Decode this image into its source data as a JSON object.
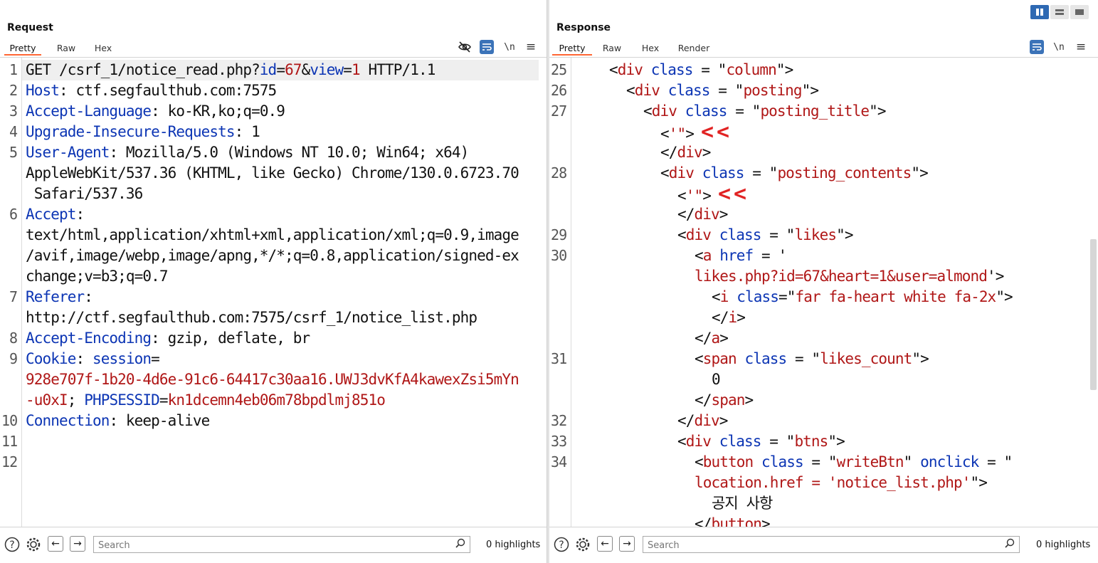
{
  "request": {
    "title": "Request",
    "tabs": [
      "Pretty",
      "Raw",
      "Hex"
    ],
    "newline_label": "\\n",
    "menu_glyph": "≡",
    "lines": [
      {
        "n": "1",
        "parts": [
          [
            "t",
            "GET /csrf_1/notice_read.php?"
          ],
          [
            "k",
            "id"
          ],
          [
            "t",
            "="
          ],
          [
            "v",
            "67"
          ],
          [
            "t",
            "&"
          ],
          [
            "k",
            "view"
          ],
          [
            "t",
            "="
          ],
          [
            "v",
            "1"
          ],
          [
            "t",
            " HTTP/1.1"
          ]
        ]
      },
      {
        "n": "2",
        "parts": [
          [
            "k",
            "Host"
          ],
          [
            "t",
            ": ctf.segfaulthub.com:7575"
          ]
        ]
      },
      {
        "n": "3",
        "parts": [
          [
            "k",
            "Accept-Language"
          ],
          [
            "t",
            ": ko-KR,ko;q=0.9"
          ]
        ]
      },
      {
        "n": "4",
        "parts": [
          [
            "k",
            "Upgrade-Insecure-Requests"
          ],
          [
            "t",
            ": 1"
          ]
        ]
      },
      {
        "n": "5",
        "parts": [
          [
            "k",
            "User-Agent"
          ],
          [
            "t",
            ": Mozilla/5.0 (Windows NT 10.0; Win64; x64)"
          ]
        ]
      },
      {
        "n": "",
        "parts": [
          [
            "t",
            "AppleWebKit/537.36 (KHTML, like Gecko) Chrome/130.0.6723.70"
          ]
        ]
      },
      {
        "n": "",
        "parts": [
          [
            "t",
            " Safari/537.36"
          ]
        ]
      },
      {
        "n": "6",
        "parts": [
          [
            "k",
            "Accept"
          ],
          [
            "t",
            ":"
          ]
        ]
      },
      {
        "n": "",
        "parts": [
          [
            "t",
            "text/html,application/xhtml+xml,application/xml;q=0.9,image"
          ]
        ]
      },
      {
        "n": "",
        "parts": [
          [
            "t",
            "/avif,image/webp,image/apng,*/*;q=0.8,application/signed-ex"
          ]
        ]
      },
      {
        "n": "",
        "parts": [
          [
            "t",
            "change;v=b3;q=0.7"
          ]
        ]
      },
      {
        "n": "7",
        "parts": [
          [
            "k",
            "Referer"
          ],
          [
            "t",
            ":"
          ]
        ]
      },
      {
        "n": "",
        "parts": [
          [
            "t",
            "http://ctf.segfaulthub.com:7575/csrf_1/notice_list.php"
          ]
        ]
      },
      {
        "n": "8",
        "parts": [
          [
            "k",
            "Accept-Encoding"
          ],
          [
            "t",
            ": gzip, deflate, br"
          ]
        ]
      },
      {
        "n": "9",
        "parts": [
          [
            "k",
            "Cookie"
          ],
          [
            "t",
            ": "
          ],
          [
            "k",
            "session"
          ],
          [
            "t",
            "="
          ]
        ]
      },
      {
        "n": "",
        "parts": [
          [
            "v",
            "928e707f-1b20-4d6e-91c6-64417c30aa16.UWJ3dvKfA4kawexZsi5mYn"
          ]
        ]
      },
      {
        "n": "",
        "parts": [
          [
            "v",
            "-u0xI"
          ],
          [
            "t",
            "; "
          ],
          [
            "k",
            "PHPSESSID"
          ],
          [
            "t",
            "="
          ],
          [
            "v",
            "kn1dcemn4eb06m78bpdlmj851o"
          ]
        ]
      },
      {
        "n": "10",
        "parts": [
          [
            "k",
            "Connection"
          ],
          [
            "t",
            ": keep-alive"
          ]
        ]
      },
      {
        "n": "11",
        "parts": []
      },
      {
        "n": "12",
        "parts": []
      }
    ],
    "search_placeholder": "Search",
    "highlights": "0 highlights"
  },
  "response": {
    "title": "Response",
    "tabs": [
      "Pretty",
      "Raw",
      "Hex",
      "Render"
    ],
    "newline_label": "\\n",
    "menu_glyph": "≡",
    "lines": [
      {
        "n": "25",
        "indent": 4,
        "parts": [
          [
            "t",
            "<"
          ],
          [
            "v",
            "div"
          ],
          [
            "t",
            " "
          ],
          [
            "k",
            "class"
          ],
          [
            "t",
            " = \""
          ],
          [
            "v",
            "column"
          ],
          [
            "t",
            "\">"
          ]
        ]
      },
      {
        "n": "26",
        "indent": 6,
        "parts": [
          [
            "t",
            "<"
          ],
          [
            "v",
            "div"
          ],
          [
            "t",
            " "
          ],
          [
            "k",
            "class"
          ],
          [
            "t",
            " = \""
          ],
          [
            "v",
            "posting"
          ],
          [
            "t",
            "\">"
          ]
        ]
      },
      {
        "n": "27",
        "indent": 8,
        "parts": [
          [
            "t",
            "<"
          ],
          [
            "v",
            "div"
          ],
          [
            "t",
            " "
          ],
          [
            "k",
            "class"
          ],
          [
            "t",
            " = \""
          ],
          [
            "v",
            "posting_title"
          ],
          [
            "t",
            "\">"
          ]
        ]
      },
      {
        "n": "",
        "indent": 10,
        "parts": [
          [
            "t",
            "<"
          ],
          [
            "v",
            "'\""
          ],
          [
            "t",
            ">"
          ]
        ],
        "arrow": "<<"
      },
      {
        "n": "",
        "indent": 10,
        "parts": [
          [
            "t",
            "</"
          ],
          [
            "v",
            "div"
          ],
          [
            "t",
            ">"
          ]
        ]
      },
      {
        "n": "28",
        "indent": 10,
        "parts": [
          [
            "t",
            "<"
          ],
          [
            "v",
            "div"
          ],
          [
            "t",
            " "
          ],
          [
            "k",
            "class"
          ],
          [
            "t",
            " = \""
          ],
          [
            "v",
            "posting_contents"
          ],
          [
            "t",
            "\">"
          ]
        ]
      },
      {
        "n": "",
        "indent": 12,
        "parts": [
          [
            "t",
            "<"
          ],
          [
            "v",
            "'\""
          ],
          [
            "t",
            ">"
          ]
        ],
        "arrow": "<<"
      },
      {
        "n": "",
        "indent": 12,
        "parts": [
          [
            "t",
            "</"
          ],
          [
            "v",
            "div"
          ],
          [
            "t",
            ">"
          ]
        ]
      },
      {
        "n": "29",
        "indent": 12,
        "parts": [
          [
            "t",
            "<"
          ],
          [
            "v",
            "div"
          ],
          [
            "t",
            " "
          ],
          [
            "k",
            "class"
          ],
          [
            "t",
            " = \""
          ],
          [
            "v",
            "likes"
          ],
          [
            "t",
            "\">"
          ]
        ]
      },
      {
        "n": "30",
        "indent": 14,
        "parts": [
          [
            "t",
            "<"
          ],
          [
            "v",
            "a"
          ],
          [
            "t",
            " "
          ],
          [
            "k",
            "href"
          ],
          [
            "t",
            " = '"
          ]
        ]
      },
      {
        "n": "",
        "indent": 14,
        "parts": [
          [
            "v",
            "likes.php?id=67&heart=1&user=almond"
          ],
          [
            "t",
            "'>"
          ]
        ]
      },
      {
        "n": "",
        "indent": 16,
        "parts": [
          [
            "t",
            "<"
          ],
          [
            "v",
            "i"
          ],
          [
            "t",
            " "
          ],
          [
            "k",
            "class"
          ],
          [
            "t",
            "=\""
          ],
          [
            "v",
            "far fa-heart white fa-2x"
          ],
          [
            "t",
            "\">"
          ]
        ]
      },
      {
        "n": "",
        "indent": 16,
        "parts": [
          [
            "t",
            "</"
          ],
          [
            "v",
            "i"
          ],
          [
            "t",
            ">"
          ]
        ]
      },
      {
        "n": "",
        "indent": 14,
        "parts": [
          [
            "t",
            "</"
          ],
          [
            "v",
            "a"
          ],
          [
            "t",
            ">"
          ]
        ]
      },
      {
        "n": "31",
        "indent": 14,
        "parts": [
          [
            "t",
            "<"
          ],
          [
            "v",
            "span"
          ],
          [
            "t",
            " "
          ],
          [
            "k",
            "class"
          ],
          [
            "t",
            " = \""
          ],
          [
            "v",
            "likes_count"
          ],
          [
            "t",
            "\">"
          ]
        ]
      },
      {
        "n": "",
        "indent": 16,
        "parts": [
          [
            "t",
            "0"
          ]
        ]
      },
      {
        "n": "",
        "indent": 14,
        "parts": [
          [
            "t",
            "</"
          ],
          [
            "v",
            "span"
          ],
          [
            "t",
            ">"
          ]
        ]
      },
      {
        "n": "32",
        "indent": 12,
        "parts": [
          [
            "t",
            "</"
          ],
          [
            "v",
            "div"
          ],
          [
            "t",
            ">"
          ]
        ]
      },
      {
        "n": "33",
        "indent": 12,
        "parts": [
          [
            "t",
            "<"
          ],
          [
            "v",
            "div"
          ],
          [
            "t",
            " "
          ],
          [
            "k",
            "class"
          ],
          [
            "t",
            " = \""
          ],
          [
            "v",
            "btns"
          ],
          [
            "t",
            "\">"
          ]
        ]
      },
      {
        "n": "34",
        "indent": 14,
        "parts": [
          [
            "t",
            "<"
          ],
          [
            "v",
            "button"
          ],
          [
            "t",
            " "
          ],
          [
            "k",
            "class"
          ],
          [
            "t",
            " = \""
          ],
          [
            "v",
            "writeBtn"
          ],
          [
            "t",
            "\" "
          ],
          [
            "k",
            "onclick"
          ],
          [
            "t",
            " = \""
          ]
        ]
      },
      {
        "n": "",
        "indent": 14,
        "parts": [
          [
            "v",
            "location.href = 'notice_list.php'"
          ],
          [
            "t",
            "\">"
          ]
        ]
      },
      {
        "n": "",
        "indent": 16,
        "parts": [
          [
            "t",
            "공지 사항"
          ]
        ]
      },
      {
        "n": "",
        "indent": 14,
        "parts": [
          [
            "t",
            "</"
          ],
          [
            "v",
            "button"
          ],
          [
            "t",
            ">"
          ]
        ]
      }
    ],
    "search_placeholder": "Search",
    "highlights": "0 highlights"
  },
  "colors": {
    "key": "#0c35b4",
    "value": "#b01717",
    "accent": "#ff6633",
    "annotation": "#e12323",
    "toolbar_active": "#3b73b8"
  },
  "icons": [
    "eye-off-icon",
    "wrap-icon",
    "newline-icon",
    "menu-icon",
    "help-icon",
    "gear-icon",
    "arrow-left-icon",
    "arrow-right-icon",
    "search-icon",
    "layout-side-icon",
    "layout-stack-icon",
    "layout-tab-icon"
  ]
}
